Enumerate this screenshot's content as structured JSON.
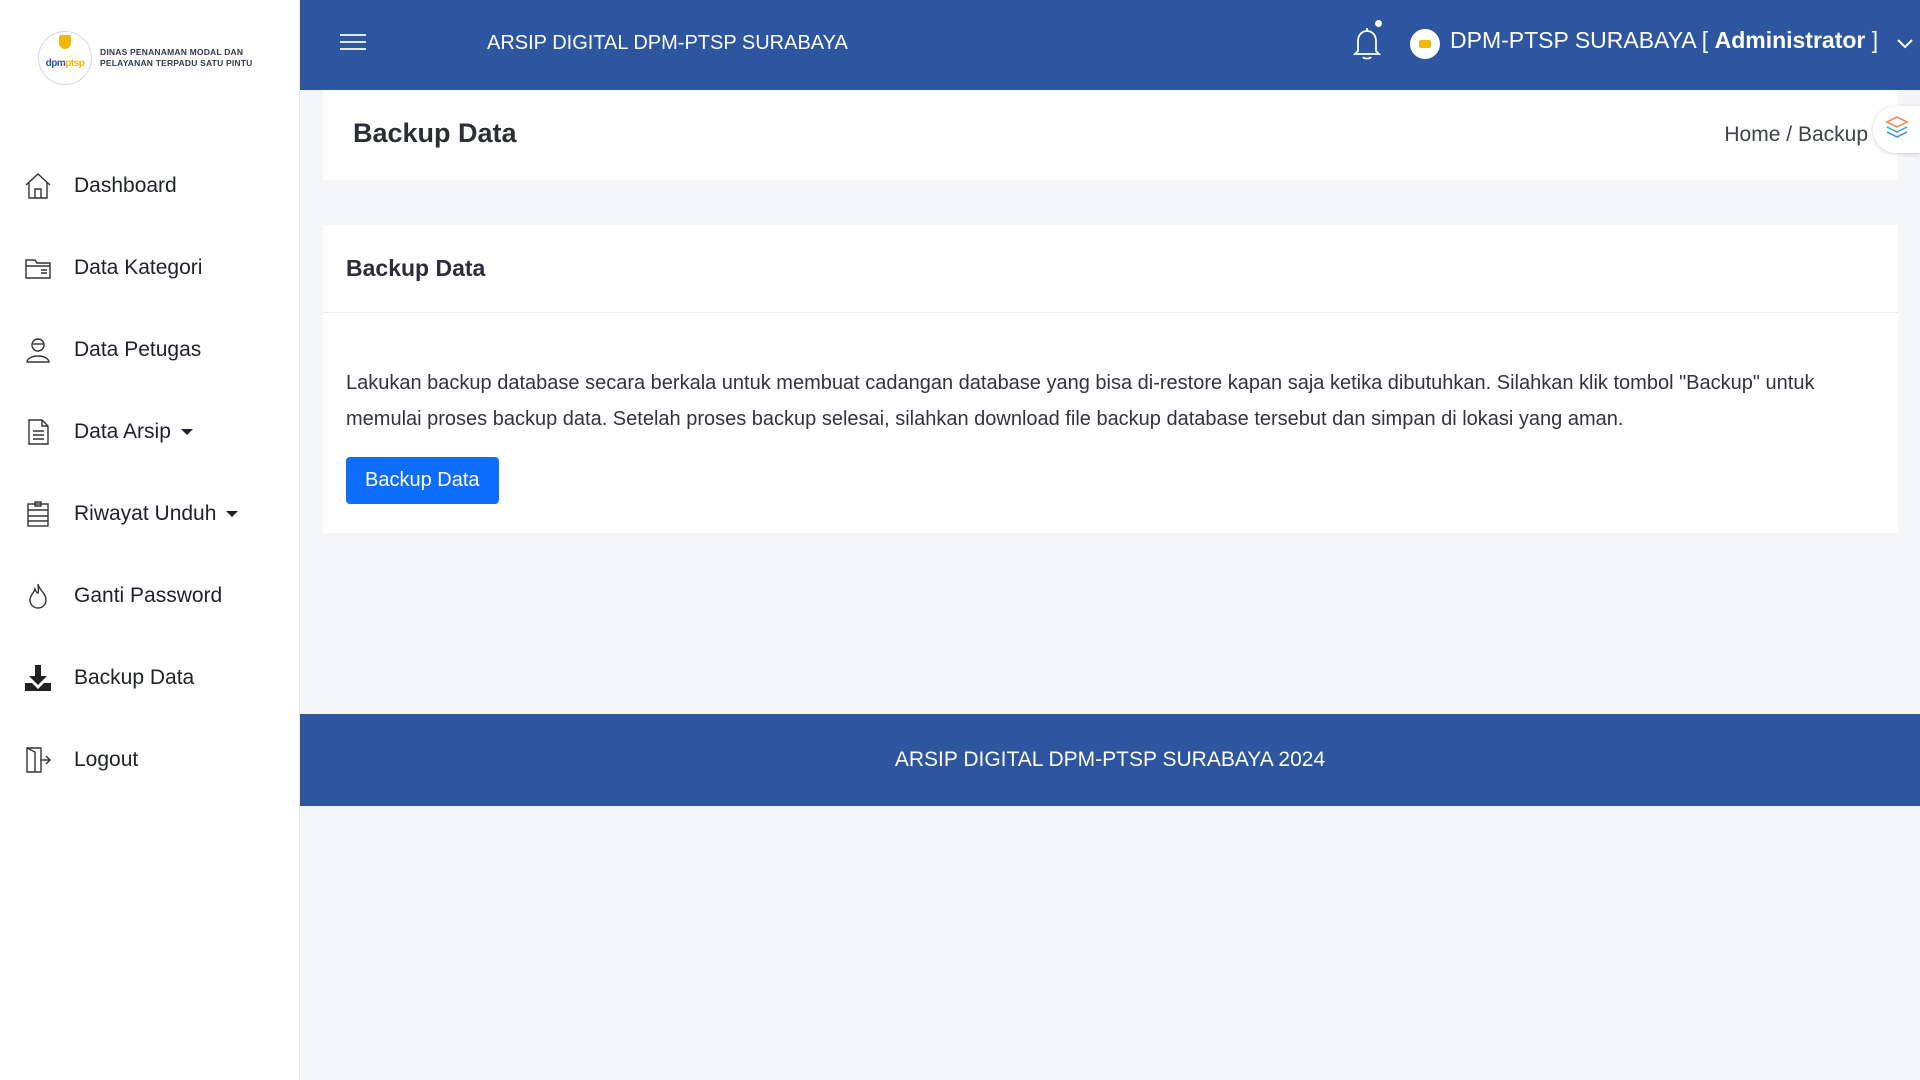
{
  "app": {
    "title": "ARSIP DIGITAL DPM-PTSP SURABAYA"
  },
  "logo": {
    "text_line1": "DINAS PENANAMAN MODAL DAN",
    "text_line2": "PELAYANAN TERPADU SATU PINTU"
  },
  "topbar": {
    "user_name": "DPM-PTSP SURABAYA [",
    "user_role": "Administrator",
    "user_suffix": "]"
  },
  "sidebar": {
    "items": [
      {
        "label": "Dashboard",
        "icon": "home-icon"
      },
      {
        "label": "Data Kategori",
        "icon": "folder-icon"
      },
      {
        "label": "Data Petugas",
        "icon": "user-icon"
      },
      {
        "label": "Data Arsip",
        "icon": "document-icon",
        "dropdown": true
      },
      {
        "label": "Riwayat Unduh",
        "icon": "archive-icon",
        "dropdown": true
      },
      {
        "label": "Ganti Password",
        "icon": "flame-icon"
      },
      {
        "label": "Backup Data",
        "icon": "download-icon"
      },
      {
        "label": "Logout",
        "icon": "logout-icon"
      }
    ]
  },
  "page_header": {
    "title": "Backup Data",
    "breadcrumb_home": "Home",
    "breadcrumb_sep": "/",
    "breadcrumb_current": "Backup"
  },
  "card": {
    "title": "Backup Data",
    "description": "Lakukan backup database secara berkala untuk membuat cadangan database yang bisa di-restore kapan saja ketika dibutuhkan. Silahkan klik tombol \"Backup\" untuk memulai proses backup data. Setelah proses backup selesai, silahkan download file backup database tersebut dan simpan di lokasi yang aman.",
    "button_label": "Backup Data"
  },
  "footer": {
    "text": "ARSIP DIGITAL DPM-PTSP SURABAYA 2024"
  },
  "colors": {
    "primary": "#2d55a0",
    "button": "#0d6efd"
  }
}
